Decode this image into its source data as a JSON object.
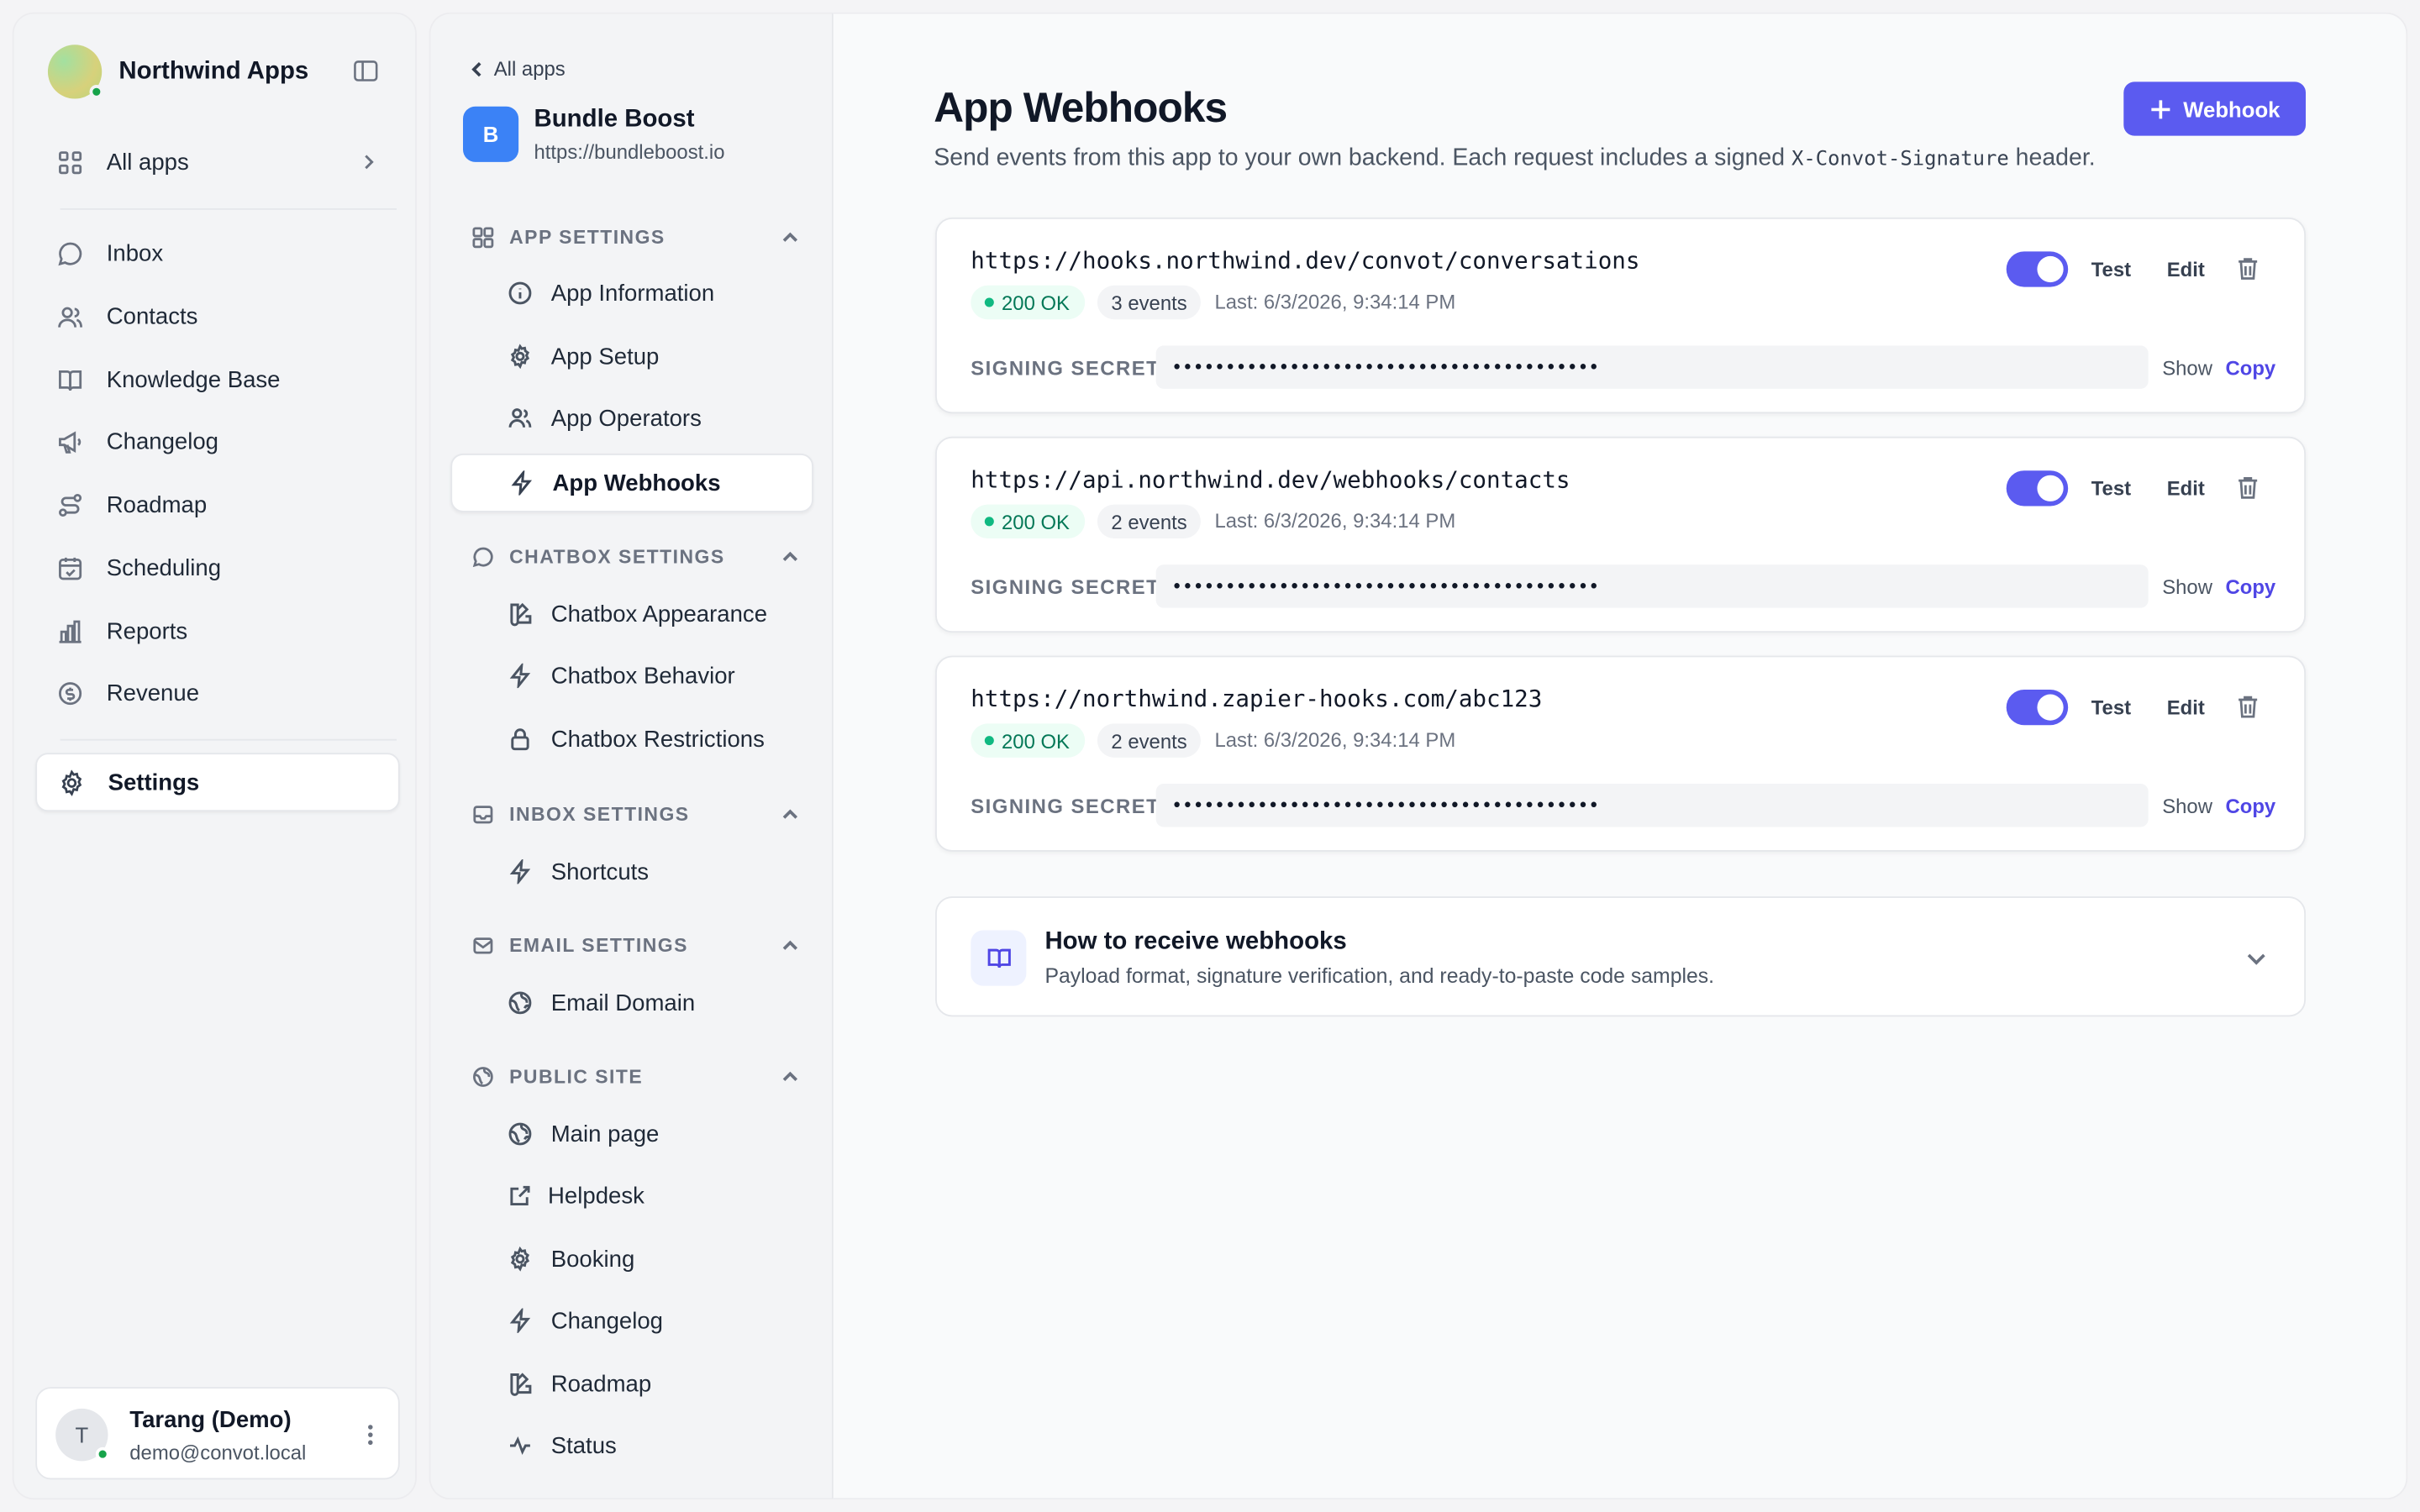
{
  "sidebar": {
    "brand": "Northwind Apps",
    "all_apps": "All apps",
    "items": [
      {
        "label": "Inbox"
      },
      {
        "label": "Contacts"
      },
      {
        "label": "Knowledge Base"
      },
      {
        "label": "Changelog"
      },
      {
        "label": "Roadmap"
      },
      {
        "label": "Scheduling"
      },
      {
        "label": "Reports"
      },
      {
        "label": "Revenue"
      }
    ],
    "settings": "Settings",
    "user": {
      "initial": "T",
      "name": "Tarang (Demo)",
      "email": "demo@convot.local"
    }
  },
  "settings_panel": {
    "back": "All apps",
    "app": {
      "initial": "B",
      "name": "Bundle Boost",
      "url": "https://bundleboost.io"
    },
    "sections": [
      {
        "title": "APP SETTINGS",
        "items": [
          "App Information",
          "App Setup",
          "App Operators",
          "App Webhooks"
        ]
      },
      {
        "title": "CHATBOX SETTINGS",
        "items": [
          "Chatbox Appearance",
          "Chatbox Behavior",
          "Chatbox Restrictions"
        ]
      },
      {
        "title": "INBOX SETTINGS",
        "items": [
          "Shortcuts"
        ]
      },
      {
        "title": "EMAIL SETTINGS",
        "items": [
          "Email Domain"
        ]
      },
      {
        "title": "PUBLIC SITE",
        "items": [
          "Main page",
          "Helpdesk",
          "Booking",
          "Changelog",
          "Roadmap",
          "Status"
        ]
      }
    ],
    "active_item": "App Webhooks"
  },
  "main": {
    "title": "App Webhooks",
    "description_pre": "Send events from this app to your own backend. Each request includes a signed ",
    "description_code": "X-Convot-Signature",
    "description_post": " header.",
    "add_button": "Webhook",
    "webhooks": [
      {
        "url": "https://hooks.northwind.dev/convot/conversations",
        "status": "200 OK",
        "events": "3 events",
        "last": "Last: 6/3/2026, 9:34:14 PM",
        "enabled": true,
        "secret": "••••••••••••••••••••••••••••••••••••••••"
      },
      {
        "url": "https://api.northwind.dev/webhooks/contacts",
        "status": "200 OK",
        "events": "2 events",
        "last": "Last: 6/3/2026, 9:34:14 PM",
        "enabled": true,
        "secret": "••••••••••••••••••••••••••••••••••••••••"
      },
      {
        "url": "https://northwind.zapier-hooks.com/abc123",
        "status": "200 OK",
        "events": "2 events",
        "last": "Last: 6/3/2026, 9:34:14 PM",
        "enabled": true,
        "secret": "••••••••••••••••••••••••••••••••••••••••"
      }
    ],
    "labels": {
      "test": "Test",
      "edit": "Edit",
      "signing_secret": "SIGNING SECRET",
      "show": "Show",
      "copy": "Copy"
    },
    "help": {
      "title": "How to receive webhooks",
      "subtitle": "Payload format, signature verification, and ready-to-paste code samples."
    }
  },
  "colors": {
    "accent": "#5b5bf0",
    "success": "#10b981",
    "app_badge": "#3b82f6"
  }
}
